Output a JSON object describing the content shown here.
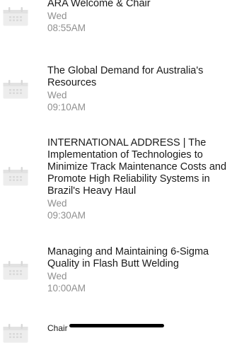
{
  "sessions": [
    {
      "title": "ARA Welcome & Chair",
      "day": "Wed",
      "time": "08:55AM"
    },
    {
      "title": "The Global Demand for Australia's Resources",
      "day": "Wed",
      "time": "09:10AM"
    },
    {
      "title": "INTERNATIONAL ADDRESS | The Implementation of Technologies to Minimize Track Maintenance Costs and Promote High Reliability Systems in Brazil's Heavy Haul",
      "day": "Wed",
      "time": "09:30AM"
    },
    {
      "title": "Managing and Maintaining 6-Sigma Quality in Flash Butt Welding",
      "day": "Wed",
      "time": "10:00AM"
    },
    {
      "title": "Chair",
      "day": "",
      "time": ""
    }
  ],
  "icon": "calendar-icon",
  "colors": {
    "title": "#1a1a1a",
    "meta": "#8f8f8f",
    "icon": "#e3e3e3"
  }
}
